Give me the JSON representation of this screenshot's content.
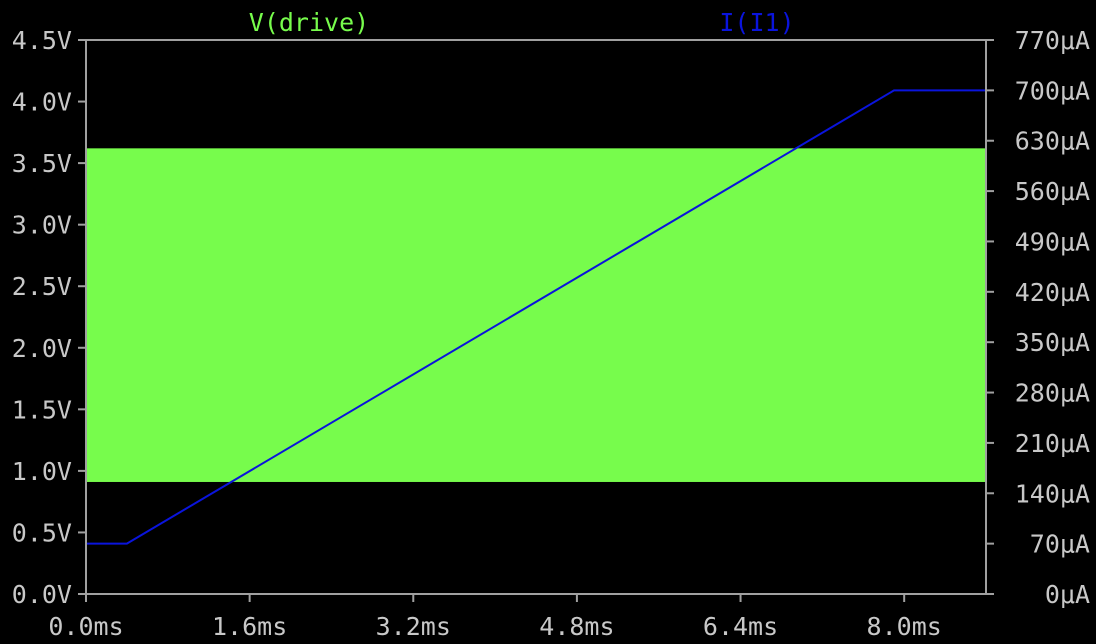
{
  "chart_data": {
    "type": "line",
    "title": "",
    "xlabel": "",
    "x_ticks": [
      "0.0ms",
      "1.6ms",
      "3.2ms",
      "4.8ms",
      "6.4ms",
      "8.0ms"
    ],
    "xlim": [
      0,
      8.8
    ],
    "left_axis": {
      "ticks": [
        "0.0V",
        "0.5V",
        "1.0V",
        "1.5V",
        "2.0V",
        "2.5V",
        "3.0V",
        "3.5V",
        "4.0V",
        "4.5V"
      ],
      "ylim": [
        0,
        4.5
      ]
    },
    "right_axis": {
      "ticks": [
        "0μA",
        "70μA",
        "140μA",
        "210μA",
        "280μA",
        "350μA",
        "420μA",
        "490μA",
        "560μA",
        "630μA",
        "700μA",
        "770μA"
      ],
      "ylim": [
        0,
        770
      ]
    },
    "grid": false,
    "series": [
      {
        "name": "V(drive)",
        "axis": "left",
        "color": "#77fc4c",
        "kind": "band",
        "x_range": [
          0,
          8.8
        ],
        "y_low": 0.91,
        "y_high": 3.62
      },
      {
        "name": "I(I1)",
        "axis": "right",
        "color": "#0a14dc",
        "x": [
          0,
          0.4,
          7.9,
          8.8
        ],
        "y": [
          70,
          70,
          700,
          700
        ]
      }
    ]
  }
}
